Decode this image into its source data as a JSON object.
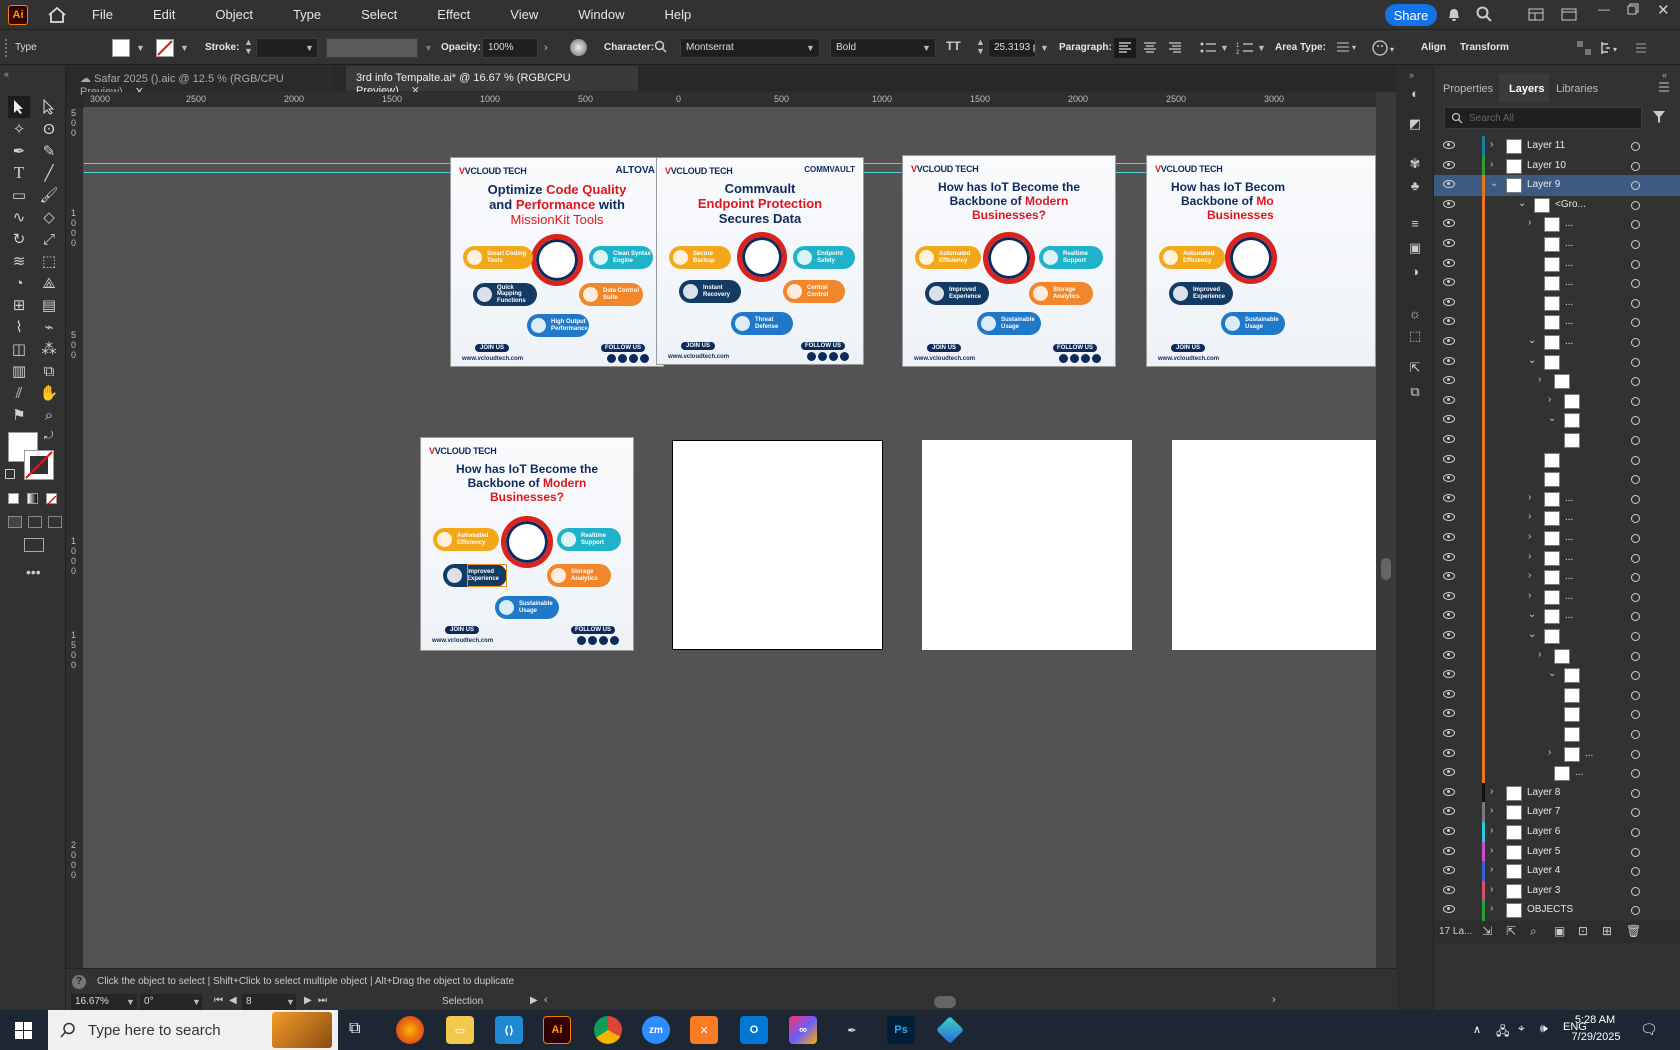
{
  "app": {
    "logo": "Ai"
  },
  "menu": [
    "File",
    "Edit",
    "Object",
    "Type",
    "Select",
    "Effect",
    "View",
    "Window",
    "Help"
  ],
  "share_label": "Share",
  "control": {
    "mode": "Type",
    "stroke_label": "Stroke:",
    "opacity_label": "Opacity:",
    "opacity_value": "100%",
    "character_label": "Character:",
    "font_family": "Montserrat",
    "font_style": "Bold",
    "font_size": "25.3193 pt",
    "paragraph_label": "Paragraph:",
    "area_type_label": "Area Type:",
    "align_label": "Align",
    "transform_label": "Transform"
  },
  "tabs": [
    {
      "label": "Safar 2025 ().aic @ 12.5 % (RGB/CPU Preview)",
      "active": false
    },
    {
      "label": "3rd info Tempalte.ai* @ 16.67 % (RGB/CPU Preview)",
      "active": true
    }
  ],
  "ruler_h": [
    "3000",
    "2500",
    "2000",
    "1500",
    "1000",
    "500",
    "0",
    "500",
    "1000",
    "1500",
    "2000",
    "2500",
    "3000"
  ],
  "ruler_v": [
    "5",
    "0",
    "0",
    "1",
    "0",
    "0",
    "0",
    "5",
    "0",
    "0",
    "1",
    "0",
    "0",
    "0",
    "1",
    "5",
    "0",
    "0",
    "2",
    "0",
    "0",
    "0"
  ],
  "cards": [
    {
      "brand": "VCLOUD TECH",
      "partner": "ALTOVA",
      "title_parts": [
        "Optimize ",
        "Code Quality",
        " and ",
        "Performance",
        " with ",
        "MissionKit Tools"
      ],
      "pills": [
        "Smart Coding Tools",
        "Clean Syntax Engine",
        "Quick Mapping Functions",
        "Data Control Suite",
        "High Output Performance"
      ],
      "join": "JOIN US",
      "follow": "FOLLOW US",
      "url": "www.vcloudtech.com"
    },
    {
      "brand": "VCLOUD TECH",
      "partner": "COMMVAULT",
      "title_parts": [
        "Commvault",
        "Endpoint Protection",
        "Secures Data"
      ],
      "pills": [
        "Secure Backup",
        "Endpoint Safety",
        "Instant Recovery",
        "Central Control",
        "Threat Defense"
      ],
      "join": "JOIN US",
      "follow": "FOLLOW US",
      "url": "www.vcloudtech.com"
    },
    {
      "brand": "VCLOUD TECH",
      "partner": "",
      "title_parts": [
        "How has IoT Become the",
        "Backbone of ",
        "Modern",
        "Businesses?"
      ],
      "pills": [
        "Automated Efficiency",
        "Realtime Support",
        "Improved Experience",
        "Storage Analytics",
        "Sustainable Usage"
      ],
      "join": "JOIN US",
      "follow": "FOLLOW US",
      "url": "www.vcloudtech.com"
    },
    {
      "brand": "VCLOUD TECH",
      "partner": "",
      "title_parts": [
        "How has IoT Becom",
        "Backbone of ",
        "Mo",
        "Businesses"
      ],
      "pills": [
        "Automated Efficiency",
        "Improved Experience",
        "Sustainable Usage"
      ],
      "join": "JOIN US",
      "follow": "",
      "url": "www.vcloudtech.com"
    },
    {
      "brand": "VCLOUD TECH",
      "partner": "",
      "title_parts": [
        "How has IoT Become the",
        "Backbone of ",
        "Modern",
        "Businesses?"
      ],
      "pills": [
        "Automated Efficiency",
        "Realtime Support",
        "Improved Experience",
        "Storage Analytics",
        "Sustainable Usage"
      ],
      "join": "JOIN US",
      "follow": "FOLLOW US",
      "url": "www.vcloudtech.com"
    }
  ],
  "panel": {
    "tabs": [
      "Properties",
      "Layers",
      "Libraries"
    ],
    "search_placeholder": "Search All",
    "layers": [
      {
        "name": "Layer 11",
        "color": "#1b7fa0"
      },
      {
        "name": "Layer 10",
        "color": "#2f9c3a"
      },
      {
        "name": "Layer 9",
        "color": "#e8761f",
        "selected": true
      },
      {
        "name": "<Gro...",
        "color": "#e8761f"
      },
      {
        "name": "...",
        "color": "#e8761f"
      },
      {
        "name": "...",
        "color": "#e8761f"
      },
      {
        "name": "...",
        "color": "#e8761f"
      },
      {
        "name": "...",
        "color": "#e8761f"
      },
      {
        "name": "...",
        "color": "#e8761f"
      },
      {
        "name": "...",
        "color": "#e8761f"
      },
      {
        "name": "...",
        "color": "#e8761f"
      },
      {
        "name": "",
        "color": "#e8761f"
      },
      {
        "name": "",
        "color": "#e8761f"
      },
      {
        "name": "",
        "color": "#e8761f"
      },
      {
        "name": "",
        "color": "#e8761f"
      },
      {
        "name": "",
        "color": "#e8761f"
      },
      {
        "name": "",
        "color": "#e8761f"
      },
      {
        "name": "",
        "color": "#e8761f"
      },
      {
        "name": "...",
        "color": "#e8761f"
      },
      {
        "name": "...",
        "color": "#e8761f"
      },
      {
        "name": "...",
        "color": "#e8761f"
      },
      {
        "name": "...",
        "color": "#e8761f"
      },
      {
        "name": "...",
        "color": "#e8761f"
      },
      {
        "name": "...",
        "color": "#e8761f"
      },
      {
        "name": "...",
        "color": "#e8761f"
      },
      {
        "name": "",
        "color": "#e8761f"
      },
      {
        "name": "",
        "color": "#e8761f"
      },
      {
        "name": "",
        "color": "#e8761f"
      },
      {
        "name": "",
        "color": "#e8761f"
      },
      {
        "name": "",
        "color": "#e8761f"
      },
      {
        "name": "",
        "color": "#e8761f"
      },
      {
        "name": "...",
        "color": "#e8761f"
      },
      {
        "name": "...",
        "color": "#e8761f"
      },
      {
        "name": "Layer 8",
        "color": "#111111"
      },
      {
        "name": "Layer 7",
        "color": "#7a7a7a"
      },
      {
        "name": "Layer 6",
        "color": "#2fc7d8"
      },
      {
        "name": "Layer 5",
        "color": "#c64fcf"
      },
      {
        "name": "Layer 4",
        "color": "#3a5fcf"
      },
      {
        "name": "Layer 3",
        "color": "#d84f6f"
      },
      {
        "name": "OBJECTS",
        "color": "#2f9c3a"
      }
    ],
    "layer_count": "17 La..."
  },
  "status": {
    "hint": "Click the object to select  |  Shift+Click to select multiple object  |  Alt+Drag the object to duplicate",
    "zoom": "16.67%",
    "rotation": "0°",
    "artboard": "8",
    "tool": "Selection"
  },
  "taskbar": {
    "search_placeholder": "Type here to search",
    "time": "5:28 AM",
    "date": "7/29/2025",
    "apps": [
      "Firefox",
      "Files",
      "VS Code",
      "Ai",
      "Chrome",
      "Zoom",
      "XAMPP",
      "Outlook",
      "CC",
      "Pen",
      "Ps",
      "App"
    ]
  },
  "colors": {
    "accent": "#1473e6",
    "guide": "#4fd6e0",
    "brand_red": "#e0161c",
    "brand_navy": "#0d2a5c"
  }
}
